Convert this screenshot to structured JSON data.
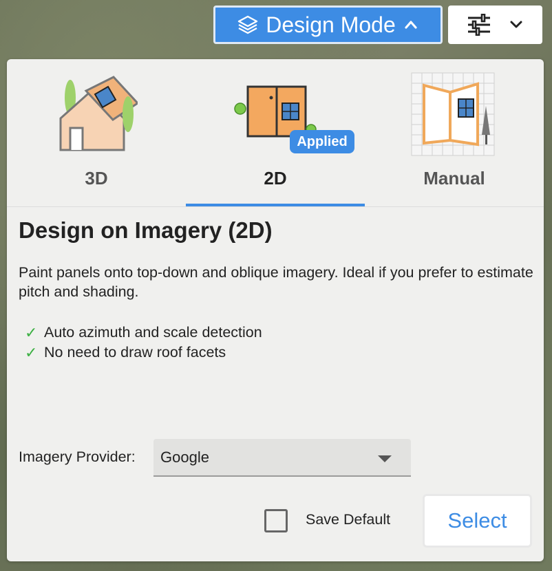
{
  "header": {
    "design_mode_label": "Design Mode",
    "design_mode_icon": "layers-icon",
    "tools_icon": "sliders-icon"
  },
  "tabs": [
    {
      "label": "3D",
      "icon": "house-3d-icon",
      "active": false
    },
    {
      "label": "2D",
      "icon": "panel-2d-icon",
      "active": true,
      "badge": "Applied"
    },
    {
      "label": "Manual",
      "icon": "manual-grid-icon",
      "active": false
    }
  ],
  "content": {
    "title": "Design on Imagery (2D)",
    "description": "Paint panels onto top-down and oblique imagery. Ideal if you prefer to estimate pitch and shading.",
    "features": [
      "Auto azimuth and scale detection",
      "No need to draw roof facets"
    ]
  },
  "form": {
    "provider_label": "Imagery Provider:",
    "provider_value": "Google",
    "save_default_label": "Save Default",
    "save_default_checked": false,
    "select_label": "Select"
  },
  "colors": {
    "accent": "#3d8ce4",
    "check": "#3cb043"
  }
}
